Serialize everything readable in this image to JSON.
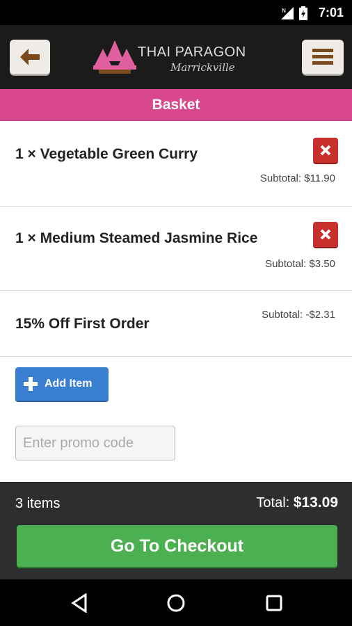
{
  "status_bar": {
    "time": "7:01"
  },
  "header": {
    "brand": "THAI PARAGON",
    "location": "Marrickville",
    "back_icon": "arrow-left-icon",
    "menu_icon": "hamburger-menu-icon"
  },
  "page": {
    "title": "Basket"
  },
  "items": [
    {
      "name": "1 × Vegetable Green Curry",
      "subtotal": "Subtotal: $11.90"
    },
    {
      "name": "1 × Medium Steamed Jasmine Rice",
      "subtotal": "Subtotal: $3.50"
    }
  ],
  "discount": {
    "name": "15% Off First Order",
    "subtotal": "Subtotal: -$2.31"
  },
  "actions": {
    "add_item": "Add Item",
    "promo_placeholder": "Enter promo code"
  },
  "footer": {
    "count": "3 items",
    "total_label": "Total:",
    "total_value": "$13.09",
    "checkout": "Go To Checkout"
  },
  "colors": {
    "accent": "#d9478c",
    "checkout": "#4caf50",
    "add_item": "#3a7ed0",
    "delete": "#c9302c"
  }
}
